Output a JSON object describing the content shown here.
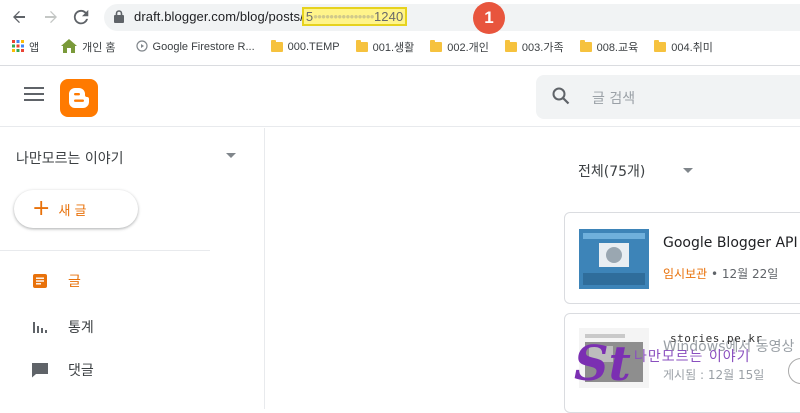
{
  "browser": {
    "url_prefix": "draft.blogger.com/blog/posts/",
    "url_masked_start": "5",
    "url_masked": "•••••••••••••••",
    "url_suffix": "1240",
    "step_badge": "1"
  },
  "bookmarks": [
    {
      "icon": "apps-grid-icon",
      "label": "앱"
    },
    {
      "icon": "home-icon",
      "label": "개인 홈"
    },
    {
      "icon": "google-icon",
      "label": "Google Firestore R..."
    },
    {
      "icon": "folder-icon",
      "label": "000.TEMP"
    },
    {
      "icon": "folder-icon",
      "label": "001.생활"
    },
    {
      "icon": "folder-icon",
      "label": "002.개인"
    },
    {
      "icon": "folder-icon",
      "label": "003.가족"
    },
    {
      "icon": "folder-icon",
      "label": "008.교육"
    },
    {
      "icon": "folder-icon",
      "label": "004.취미"
    }
  ],
  "header": {
    "search_placeholder": "글 검색"
  },
  "sidebar": {
    "blog_name": "나만모르는 이야기",
    "new_post_label": "새 글",
    "items": [
      {
        "icon": "posts-icon",
        "label": "글",
        "active": true
      },
      {
        "icon": "stats-icon",
        "label": "통계",
        "active": false
      },
      {
        "icon": "comments-icon",
        "label": "댓글",
        "active": false
      }
    ]
  },
  "main": {
    "filter_label": "전체(75개)",
    "posts": [
      {
        "title": "Google Blogger API",
        "status": "임시보관",
        "separator": "•",
        "date": "12월 22일"
      },
      {
        "title": "Windows에서 동영상",
        "status": "게시됨",
        "separator": ":",
        "date": "12월 15일"
      }
    ]
  },
  "watermark": {
    "site": "stories.pe.kr",
    "name": "나만모르는 이야기",
    "logo_letters": "St"
  },
  "colors": {
    "accent": "#e8710a",
    "blogger_orange": "#ff7a00",
    "badge_red": "#e8553d",
    "highlight": "#fff48a"
  }
}
